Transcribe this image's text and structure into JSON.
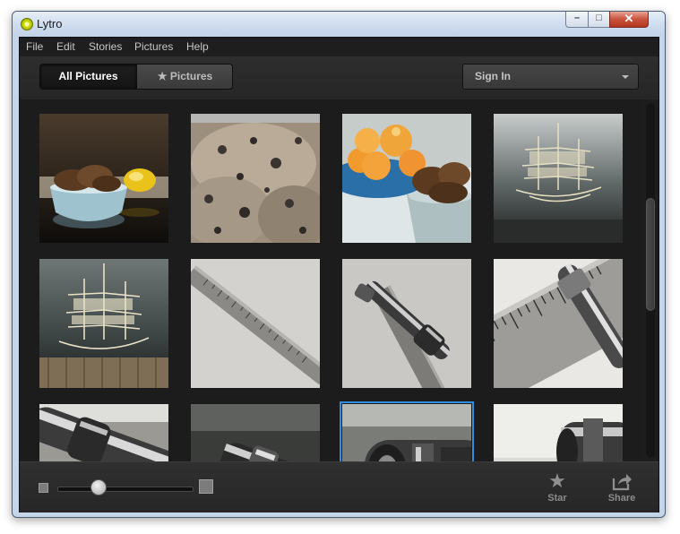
{
  "window": {
    "title": "Lytro",
    "controls": {
      "minimize": "–",
      "maximize": "□",
      "close": "✕"
    }
  },
  "menu": [
    "File",
    "Edit",
    "Stories",
    "Pictures",
    "Help"
  ],
  "toolbar": {
    "all_pictures": "All Pictures",
    "starred_pictures": "Pictures",
    "star_glyph": "★",
    "sign_in": "Sign In"
  },
  "gallery": {
    "selected_index": 10,
    "thumbnails": [
      "cookies-bowl-lemon",
      "cookies-closeup",
      "apricots-cookies",
      "ship-engraving",
      "ship-engraving-2",
      "steel-ruler",
      "airbrush-on-ruler",
      "ruler-pen-closeup",
      "airbrush-tip",
      "airbrush-nozzle",
      "airbrush-nozzle-selected",
      "airbrush-nozzle-light"
    ]
  },
  "bottom": {
    "zoom_level": 0.3,
    "star_label": "Star",
    "share_label": "Share"
  },
  "colors": {
    "selection": "#2f8cdf",
    "background": "#1c1c1c"
  }
}
